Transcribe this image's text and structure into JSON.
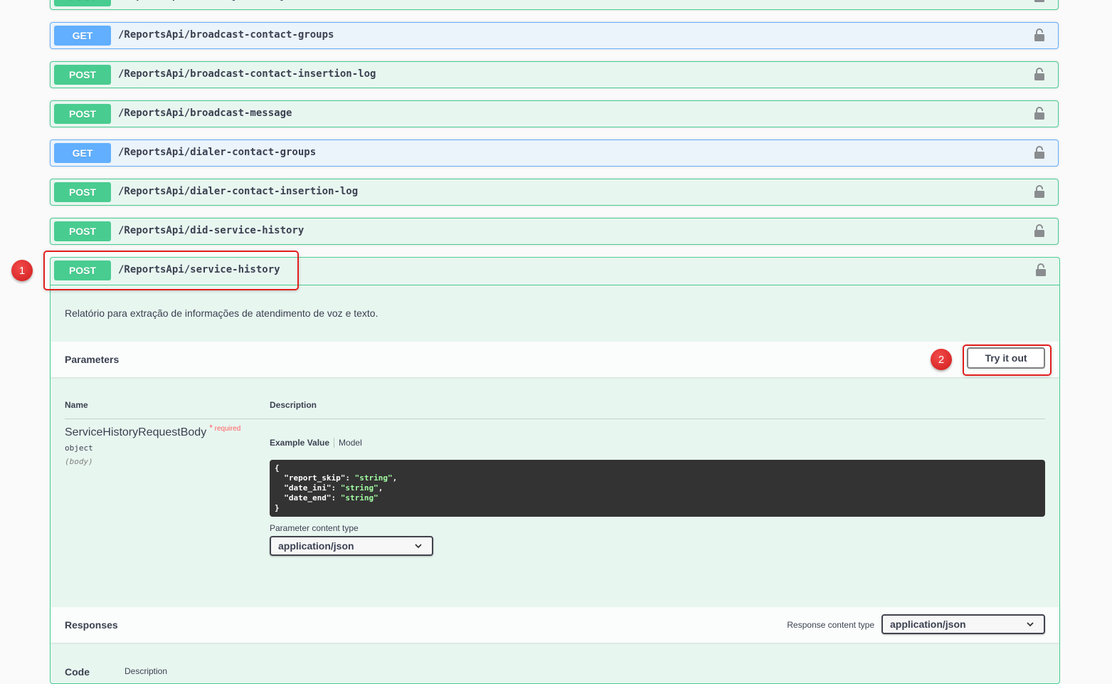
{
  "endpoints": [
    {
      "method": "POST",
      "path": "/ReportsApi/activity-history"
    },
    {
      "method": "GET",
      "path": "/ReportsApi/broadcast-contact-groups"
    },
    {
      "method": "POST",
      "path": "/ReportsApi/broadcast-contact-insertion-log"
    },
    {
      "method": "POST",
      "path": "/ReportsApi/broadcast-message"
    },
    {
      "method": "GET",
      "path": "/ReportsApi/dialer-contact-groups"
    },
    {
      "method": "POST",
      "path": "/ReportsApi/dialer-contact-insertion-log"
    },
    {
      "method": "POST",
      "path": "/ReportsApi/did-service-history"
    }
  ],
  "expanded": {
    "method": "POST",
    "path": "/ReportsApi/service-history",
    "description": "Relatório para extração de informações de atendimento de voz e texto.",
    "parameters": {
      "title": "Parameters",
      "try_it_out_label": "Try it out",
      "col_name": "Name",
      "col_description": "Description",
      "param": {
        "name": "ServiceHistoryRequestBody",
        "required_star": "*",
        "required_label": "required",
        "type": "object",
        "in": "(body)"
      },
      "tabs": {
        "example_value": "Example Value",
        "model": "Model"
      },
      "example": {
        "open": "{",
        "lines": [
          {
            "key": "\"report_skip\"",
            "value": "\"string\"",
            "comma": ","
          },
          {
            "key": "\"date_ini\"",
            "value": "\"string\"",
            "comma": ","
          },
          {
            "key": "\"date_end\"",
            "value": "\"string\"",
            "comma": ""
          }
        ],
        "close": "}"
      },
      "content_type_label": "Parameter content type",
      "content_type_value": "application/json"
    },
    "responses": {
      "title": "Responses",
      "content_type_label": "Response content type",
      "content_type_value": "application/json",
      "col_code": "Code",
      "col_description": "Description"
    }
  },
  "annotations": {
    "step1": "1",
    "step2": "2"
  },
  "colors": {
    "post": "#49cc90",
    "get": "#61affe",
    "annotation": "#e21f1f"
  }
}
